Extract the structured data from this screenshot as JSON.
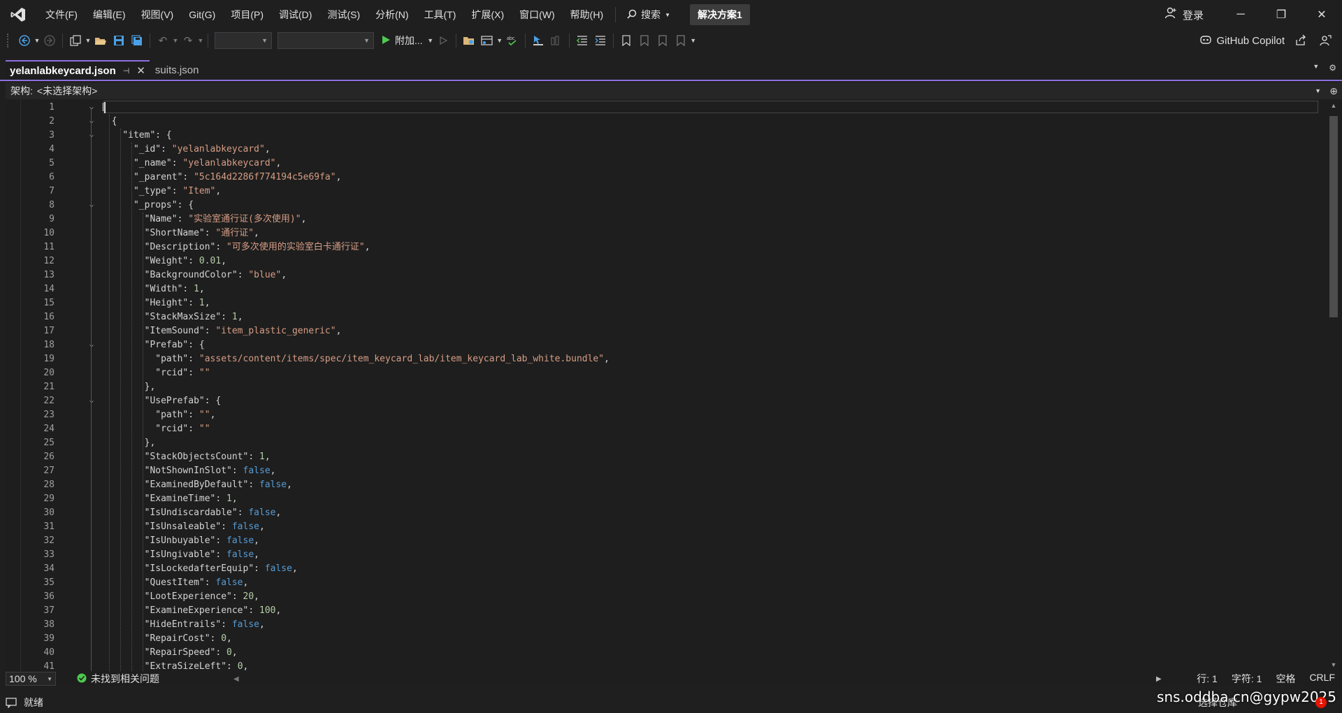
{
  "menubar": {
    "items": [
      "文件(F)",
      "编辑(E)",
      "视图(V)",
      "Git(G)",
      "项目(P)",
      "调试(D)",
      "测试(S)",
      "分析(N)",
      "工具(T)",
      "扩展(X)",
      "窗口(W)",
      "帮助(H)"
    ],
    "search_label": "搜索",
    "solution_name": "解决方案1",
    "login_label": "登录"
  },
  "toolbar": {
    "run_label": "附加...",
    "copilot_label": "GitHub Copilot"
  },
  "tabs": [
    {
      "label": "yelanlabkeycard.json",
      "active": true
    },
    {
      "label": "suits.json",
      "active": false
    }
  ],
  "navbar": {
    "label": "架构:",
    "value": "<未选择架构>"
  },
  "editor": {
    "lines": [
      [
        [
          "p",
          "["
        ]
      ],
      [
        [
          "p",
          "  {"
        ]
      ],
      [
        [
          "p",
          "    "
        ],
        [
          "k",
          "\"item\""
        ],
        [
          "p",
          ": {"
        ]
      ],
      [
        [
          "p",
          "      "
        ],
        [
          "k",
          "\"_id\""
        ],
        [
          "p",
          ": "
        ],
        [
          "s",
          "\"yelanlabkeycard\""
        ],
        [
          "p",
          ","
        ]
      ],
      [
        [
          "p",
          "      "
        ],
        [
          "k",
          "\"_name\""
        ],
        [
          "p",
          ": "
        ],
        [
          "s",
          "\"yelanlabkeycard\""
        ],
        [
          "p",
          ","
        ]
      ],
      [
        [
          "p",
          "      "
        ],
        [
          "k",
          "\"_parent\""
        ],
        [
          "p",
          ": "
        ],
        [
          "s",
          "\"5c164d2286f774194c5e69fa\""
        ],
        [
          "p",
          ","
        ]
      ],
      [
        [
          "p",
          "      "
        ],
        [
          "k",
          "\"_type\""
        ],
        [
          "p",
          ": "
        ],
        [
          "s",
          "\"Item\""
        ],
        [
          "p",
          ","
        ]
      ],
      [
        [
          "p",
          "      "
        ],
        [
          "k",
          "\"_props\""
        ],
        [
          "p",
          ": {"
        ]
      ],
      [
        [
          "p",
          "        "
        ],
        [
          "k",
          "\"Name\""
        ],
        [
          "p",
          ": "
        ],
        [
          "s",
          "\"实验室通行证(多次使用)\""
        ],
        [
          "p",
          ","
        ]
      ],
      [
        [
          "p",
          "        "
        ],
        [
          "k",
          "\"ShortName\""
        ],
        [
          "p",
          ": "
        ],
        [
          "s",
          "\"通行证\""
        ],
        [
          "p",
          ","
        ]
      ],
      [
        [
          "p",
          "        "
        ],
        [
          "k",
          "\"Description\""
        ],
        [
          "p",
          ": "
        ],
        [
          "s",
          "\"可多次使用的实验室白卡通行证\""
        ],
        [
          "p",
          ","
        ]
      ],
      [
        [
          "p",
          "        "
        ],
        [
          "k",
          "\"Weight\""
        ],
        [
          "p",
          ": "
        ],
        [
          "n",
          "0.01"
        ],
        [
          "p",
          ","
        ]
      ],
      [
        [
          "p",
          "        "
        ],
        [
          "k",
          "\"BackgroundColor\""
        ],
        [
          "p",
          ": "
        ],
        [
          "s",
          "\"blue\""
        ],
        [
          "p",
          ","
        ]
      ],
      [
        [
          "p",
          "        "
        ],
        [
          "k",
          "\"Width\""
        ],
        [
          "p",
          ": "
        ],
        [
          "n",
          "1"
        ],
        [
          "p",
          ","
        ]
      ],
      [
        [
          "p",
          "        "
        ],
        [
          "k",
          "\"Height\""
        ],
        [
          "p",
          ": "
        ],
        [
          "n",
          "1"
        ],
        [
          "p",
          ","
        ]
      ],
      [
        [
          "p",
          "        "
        ],
        [
          "k",
          "\"StackMaxSize\""
        ],
        [
          "p",
          ": "
        ],
        [
          "n",
          "1"
        ],
        [
          "p",
          ","
        ]
      ],
      [
        [
          "p",
          "        "
        ],
        [
          "k",
          "\"ItemSound\""
        ],
        [
          "p",
          ": "
        ],
        [
          "s",
          "\"item_plastic_generic\""
        ],
        [
          "p",
          ","
        ]
      ],
      [
        [
          "p",
          "        "
        ],
        [
          "k",
          "\"Prefab\""
        ],
        [
          "p",
          ": {"
        ]
      ],
      [
        [
          "p",
          "          "
        ],
        [
          "k",
          "\"path\""
        ],
        [
          "p",
          ": "
        ],
        [
          "s",
          "\"assets/content/items/spec/item_keycard_lab/item_keycard_lab_white.bundle\""
        ],
        [
          "p",
          ","
        ]
      ],
      [
        [
          "p",
          "          "
        ],
        [
          "k",
          "\"rcid\""
        ],
        [
          "p",
          ": "
        ],
        [
          "s",
          "\"\""
        ]
      ],
      [
        [
          "p",
          "        },"
        ]
      ],
      [
        [
          "p",
          "        "
        ],
        [
          "k",
          "\"UsePrefab\""
        ],
        [
          "p",
          ": {"
        ]
      ],
      [
        [
          "p",
          "          "
        ],
        [
          "k",
          "\"path\""
        ],
        [
          "p",
          ": "
        ],
        [
          "s",
          "\"\""
        ],
        [
          "p",
          ","
        ]
      ],
      [
        [
          "p",
          "          "
        ],
        [
          "k",
          "\"rcid\""
        ],
        [
          "p",
          ": "
        ],
        [
          "s",
          "\"\""
        ]
      ],
      [
        [
          "p",
          "        },"
        ]
      ],
      [
        [
          "p",
          "        "
        ],
        [
          "k",
          "\"StackObjectsCount\""
        ],
        [
          "p",
          ": "
        ],
        [
          "n",
          "1"
        ],
        [
          "p",
          ","
        ]
      ],
      [
        [
          "p",
          "        "
        ],
        [
          "k",
          "\"NotShownInSlot\""
        ],
        [
          "p",
          ": "
        ],
        [
          "b",
          "false"
        ],
        [
          "p",
          ","
        ]
      ],
      [
        [
          "p",
          "        "
        ],
        [
          "k",
          "\"ExaminedByDefault\""
        ],
        [
          "p",
          ": "
        ],
        [
          "b",
          "false"
        ],
        [
          "p",
          ","
        ]
      ],
      [
        [
          "p",
          "        "
        ],
        [
          "k",
          "\"ExamineTime\""
        ],
        [
          "p",
          ": "
        ],
        [
          "n",
          "1"
        ],
        [
          "p",
          ","
        ]
      ],
      [
        [
          "p",
          "        "
        ],
        [
          "k",
          "\"IsUndiscardable\""
        ],
        [
          "p",
          ": "
        ],
        [
          "b",
          "false"
        ],
        [
          "p",
          ","
        ]
      ],
      [
        [
          "p",
          "        "
        ],
        [
          "k",
          "\"IsUnsaleable\""
        ],
        [
          "p",
          ": "
        ],
        [
          "b",
          "false"
        ],
        [
          "p",
          ","
        ]
      ],
      [
        [
          "p",
          "        "
        ],
        [
          "k",
          "\"IsUnbuyable\""
        ],
        [
          "p",
          ": "
        ],
        [
          "b",
          "false"
        ],
        [
          "p",
          ","
        ]
      ],
      [
        [
          "p",
          "        "
        ],
        [
          "k",
          "\"IsUngivable\""
        ],
        [
          "p",
          ": "
        ],
        [
          "b",
          "false"
        ],
        [
          "p",
          ","
        ]
      ],
      [
        [
          "p",
          "        "
        ],
        [
          "k",
          "\"IsLockedafterEquip\""
        ],
        [
          "p",
          ": "
        ],
        [
          "b",
          "false"
        ],
        [
          "p",
          ","
        ]
      ],
      [
        [
          "p",
          "        "
        ],
        [
          "k",
          "\"QuestItem\""
        ],
        [
          "p",
          ": "
        ],
        [
          "b",
          "false"
        ],
        [
          "p",
          ","
        ]
      ],
      [
        [
          "p",
          "        "
        ],
        [
          "k",
          "\"LootExperience\""
        ],
        [
          "p",
          ": "
        ],
        [
          "n",
          "20"
        ],
        [
          "p",
          ","
        ]
      ],
      [
        [
          "p",
          "        "
        ],
        [
          "k",
          "\"ExamineExperience\""
        ],
        [
          "p",
          ": "
        ],
        [
          "n",
          "100"
        ],
        [
          "p",
          ","
        ]
      ],
      [
        [
          "p",
          "        "
        ],
        [
          "k",
          "\"HideEntrails\""
        ],
        [
          "p",
          ": "
        ],
        [
          "b",
          "false"
        ],
        [
          "p",
          ","
        ]
      ],
      [
        [
          "p",
          "        "
        ],
        [
          "k",
          "\"RepairCost\""
        ],
        [
          "p",
          ": "
        ],
        [
          "n",
          "0"
        ],
        [
          "p",
          ","
        ]
      ],
      [
        [
          "p",
          "        "
        ],
        [
          "k",
          "\"RepairSpeed\""
        ],
        [
          "p",
          ": "
        ],
        [
          "n",
          "0"
        ],
        [
          "p",
          ","
        ]
      ],
      [
        [
          "p",
          "        "
        ],
        [
          "k",
          "\"ExtraSizeLeft\""
        ],
        [
          "p",
          ": "
        ],
        [
          "n",
          "0"
        ],
        [
          "p",
          ","
        ]
      ]
    ],
    "fold_lines": [
      1,
      2,
      3,
      8,
      18,
      22
    ]
  },
  "edstatus": {
    "zoom": "100 %",
    "issues": "未找到相关问题",
    "line": "行: 1",
    "char": "字符: 1",
    "indent": "空格",
    "eol": "CRLF"
  },
  "statusbar": {
    "ready": "就绪",
    "source_control": "选择仓库",
    "watermark": "sns.oddba.cn@gypw2025",
    "notification_count": "1"
  },
  "colors": {
    "accent": "#8d6ee0",
    "string": "#d69d85",
    "number": "#b5cea8",
    "keyword": "#569cd6",
    "run_green": "#4ec94e"
  }
}
